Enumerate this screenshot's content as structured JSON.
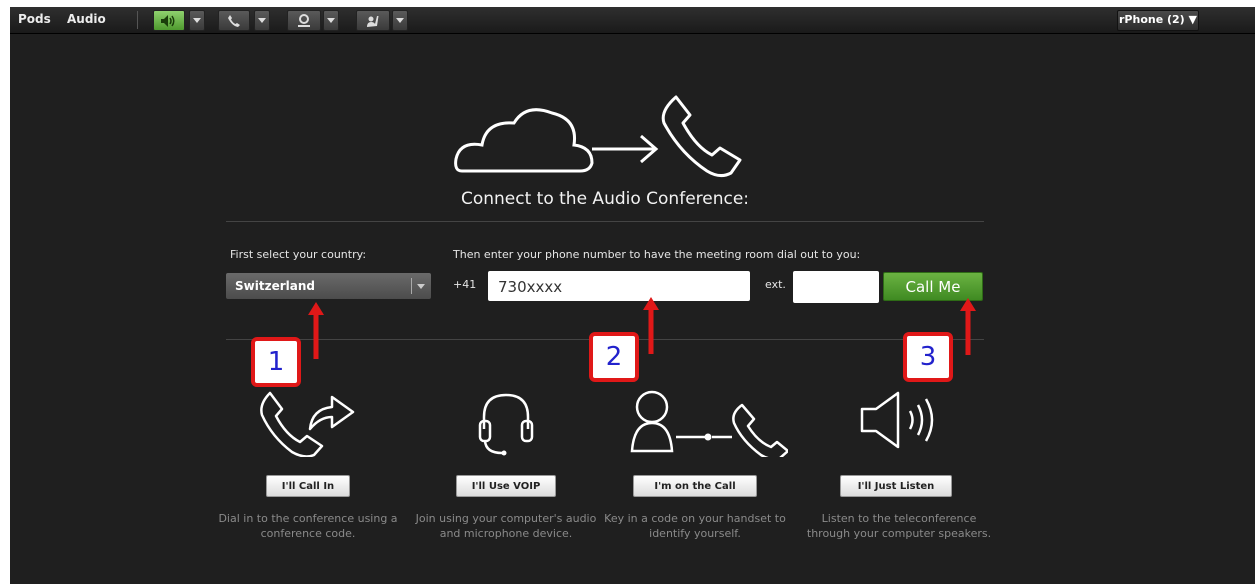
{
  "topbar": {
    "menu": [
      "Pods",
      "Audio"
    ],
    "user_button": "rPhone (2) ▼",
    "icons": [
      "speaker-icon",
      "phone-icon",
      "webcam-icon",
      "raise-hand-icon"
    ]
  },
  "main": {
    "title": "Connect to the Audio Conference:",
    "country_label": "First select your country:",
    "country_value": "Switzerland",
    "phone_label": "Then enter your phone number to have the meeting room dial out to you:",
    "prefix": "+41",
    "phone_value": "730xxxx",
    "ext_label": "ext.",
    "ext_value": "",
    "call_button": "Call Me"
  },
  "options": [
    {
      "button": "I'll Call In",
      "description": "Dial in to the conference using a conference code."
    },
    {
      "button": "I'll Use VOIP",
      "description": "Join using your computer's audio and microphone device."
    },
    {
      "button": "I'm on the Call",
      "description": "Key in a code on your handset to identify yourself."
    },
    {
      "button": "I'll Just Listen",
      "description": "Listen to the teleconference through your computer speakers."
    }
  ],
  "annotations": [
    "1",
    "2",
    "3"
  ],
  "colors": {
    "accent_green": "#4e9a2e",
    "annotation_red": "#e01818",
    "annotation_number": "#2222cc"
  }
}
